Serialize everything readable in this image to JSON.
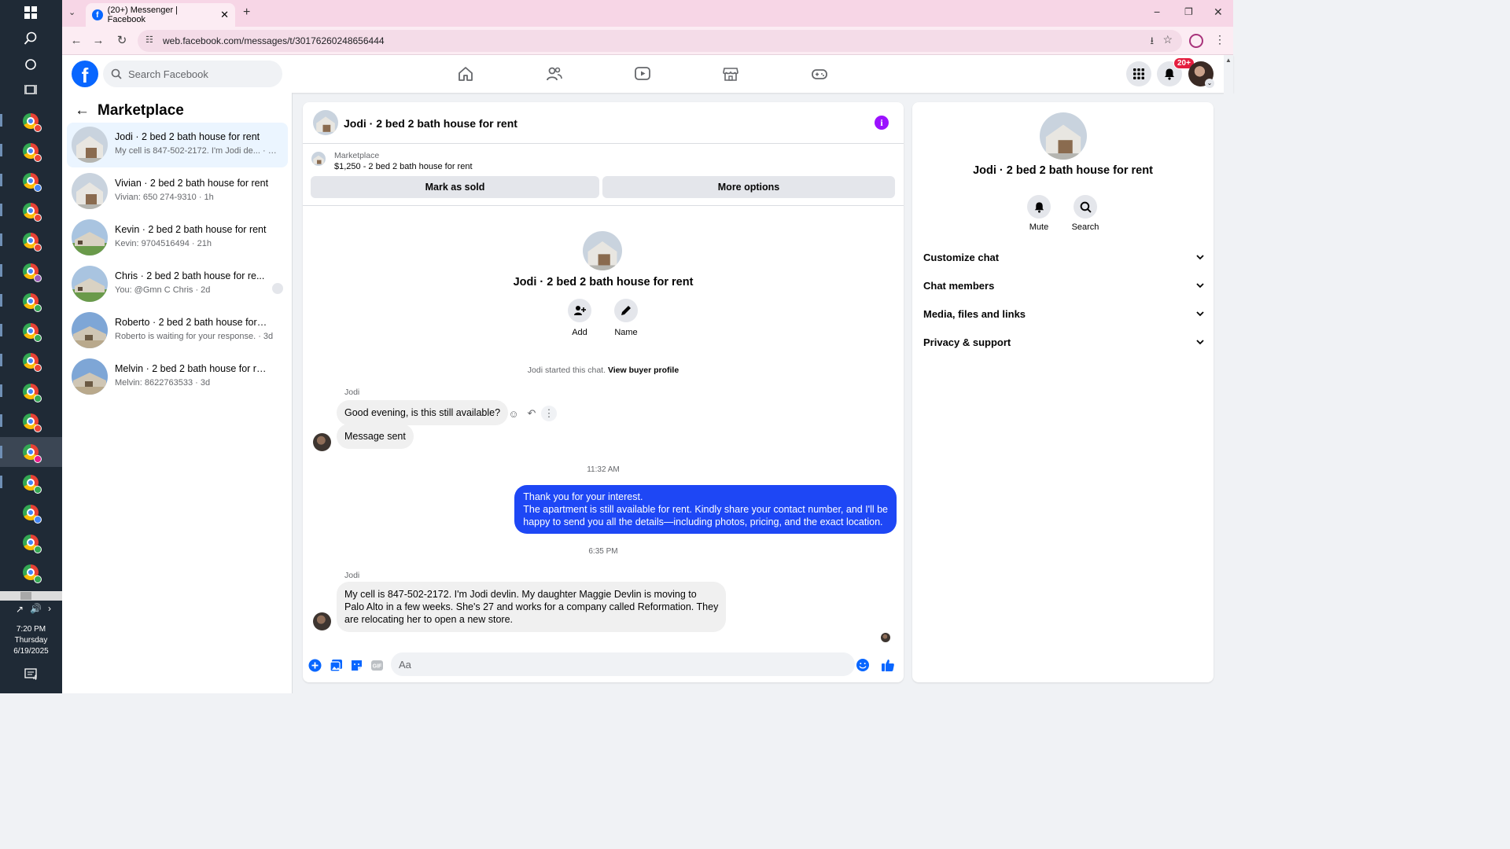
{
  "browser": {
    "tab_title": "(20+) Messenger | Facebook",
    "url": "web.facebook.com/messages/t/30176260248656444"
  },
  "taskbar": {
    "time": "7:20 PM",
    "day": "Thursday",
    "date": "6/19/2025",
    "notification_count": "4"
  },
  "header": {
    "logo": "f",
    "search_placeholder": "Search Facebook",
    "notification_badge": "20+"
  },
  "left_panel": {
    "title": "Marketplace",
    "conversations": [
      {
        "title": "Jodi · 2 bed 2 bath house for rent",
        "snippet": "My cell is 847-502-2172. I'm Jodi de... · 44m"
      },
      {
        "title": "Vivian · 2 bed 2 bath house for rent",
        "snippet": "Vivian: 650 274-9310 · 1h"
      },
      {
        "title": "Kevin · 2 bed 2 bath house for rent",
        "snippet": "Kevin: 9704516494 · 21h"
      },
      {
        "title": "Chris · 2 bed 2 bath house for re...",
        "snippet": "You: @Gmn C Chris · 2d"
      },
      {
        "title": "Roberto · 2 bed 2 bath house for r...",
        "snippet": "Roberto is waiting for your response. · 3d"
      },
      {
        "title": "Melvin · 2 bed 2 bath house for rent",
        "snippet": "Melvin: 8622763533 · 3d"
      }
    ]
  },
  "chat": {
    "title": "Jodi · 2 bed 2 bath house for rent",
    "marketplace_label": "Marketplace",
    "listing": "$1,250 - 2 bed 2 bath house for rent",
    "mark_sold_label": "Mark as sold",
    "more_options_label": "More options",
    "hero_name": "Jodi · 2 bed 2 bath house for rent",
    "add_label": "Add",
    "name_label": "Name",
    "started_text": "Jodi started this chat.",
    "view_profile": "View buyer profile",
    "sender1": "Jodi",
    "msg1": "Good evening, is this still available?",
    "msg2": "Message sent",
    "time1": "11:32 AM",
    "reply_line1": "Thank you for your interest.",
    "reply_line2": "The apartment is still available for rent. Kindly share your contact number, and I'll be",
    "reply_line3": "happy to send you all the details—including photos, pricing, and the exact location.",
    "time2": "6:35 PM",
    "sender2": "Jodi",
    "msg3_line1": "My cell is 847-502-2172. I'm Jodi devlin. My daughter Maggie Devlin is moving to",
    "msg3_line2": "Palo Alto in a few weeks. She's 27 and works for a company called Reformation. They",
    "msg3_line3": "are relocating her to open a new store.",
    "composer_placeholder": "Aa"
  },
  "right_panel": {
    "name": "Jodi · 2 bed 2 bath house for rent",
    "mute_label": "Mute",
    "search_label": "Search",
    "rows": [
      "Customize chat",
      "Chat members",
      "Media, files and links",
      "Privacy & support"
    ]
  },
  "colors": {
    "fb_blue": "#0866ff",
    "outgoing_bubble": "#1e47f5",
    "info_purple": "#9b11ff",
    "badge_red": "#e41e3f"
  }
}
